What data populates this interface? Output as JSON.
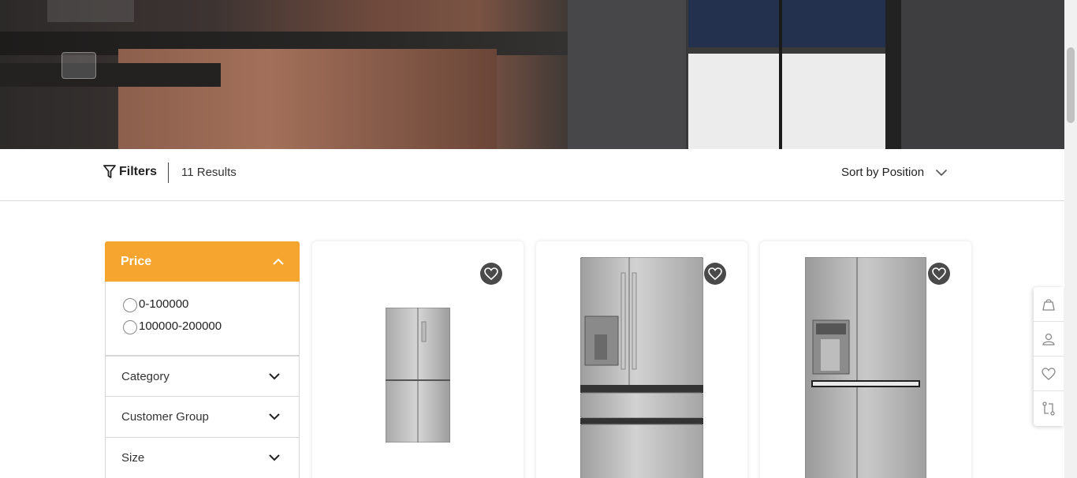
{
  "toolbar": {
    "filters_label": "Filters",
    "results_label": "11 Results",
    "sort_label": "Sort by Position"
  },
  "sidebar": {
    "price": {
      "title": "Price",
      "options": [
        "0-100000",
        "100000-200000"
      ]
    },
    "facets": [
      "Category",
      "Customer Group",
      "Size"
    ]
  },
  "colors": {
    "accent": "#f6a52f",
    "wishlist_button": "#4a4a4a"
  },
  "products": [
    {
      "image": "four-door-refrigerator",
      "wishlist_icon": "heart-icon"
    },
    {
      "image": "french-door-refrigerator",
      "wishlist_icon": "heart-icon"
    },
    {
      "image": "side-by-side-refrigerator",
      "wishlist_icon": "heart-icon"
    }
  ],
  "floating_toolbar": [
    "cart-icon",
    "user-icon",
    "heart-icon",
    "compare-icon"
  ]
}
